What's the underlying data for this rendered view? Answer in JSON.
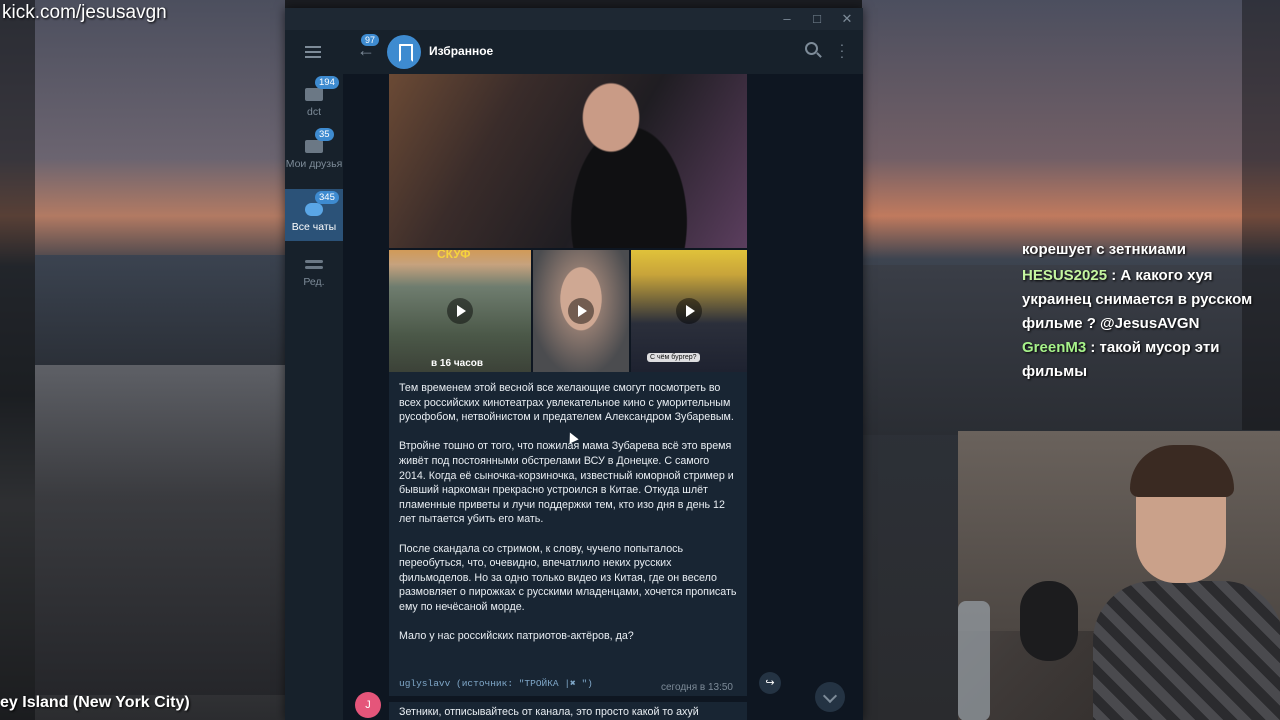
{
  "stream": {
    "url": "kick.com/jesusavgn",
    "location": "ey Island (New York City)"
  },
  "stream_chat": {
    "cut_line": "корешует с зетнкиами",
    "messages": [
      {
        "user": "HESUS2025",
        "text": ": А какого хуя украинец снимается в русском фильме ? @JesusAVGN"
      },
      {
        "user": "GreenM3",
        "text": ": такой мусор эти фильмы"
      }
    ]
  },
  "telegram": {
    "folders": [
      {
        "label": "dct",
        "badge": "194"
      },
      {
        "label": "Мои друзья",
        "badge": "35"
      },
      {
        "label": "Все чаты",
        "badge": "345"
      },
      {
        "label": "Ред.",
        "badge": ""
      }
    ],
    "header": {
      "back_badge": "97",
      "title": "Избранное"
    },
    "media": {
      "thumb1_overlay": "СКУФ",
      "thumb1_caption": "в 16 часов",
      "thumb3_question": "С чём бургер?"
    },
    "message": {
      "paragraphs": [
        "Тем временем этой весной все желающие смогут посмотреть во всех российских кинотеатрах увлекательное кино с уморительным русофобом, нетвойнистом и предателем Александром Зубаревым.",
        "Втройне тошно от того, что пожилая мама Зубарева всё это время живёт под постоянными обстрелами ВСУ в Донецке. С самого 2014. Когда её сыночка-корзиночка, известный юморной стример и бывший наркоман прекрасно устроился в Китае. Откуда шлёт пламенные приветы и лучи поддержки тем, кто изо дня в день 12 лет пытается убить его мать.",
        "После скандала со стримом, к слову, чучело попыталось переобуться, что, очевидно, впечатлило неких русских фильмоделов. Но за одно только видео из Китая, где он весело размовляет о пирожках с русскими младенцами, хочется прописать ему по нечёсаной морде.",
        "Мало у нас российских патриотов-актёров, да?"
      ],
      "signature": "uglyslavv (источник: \"ТРОЙКА |✖ \")",
      "time": "сегодня в 13:50"
    },
    "next_message": {
      "avatar_letter": "J",
      "text": "Зетники, отписывайтесь от канала, это просто какой то ахуй"
    }
  }
}
